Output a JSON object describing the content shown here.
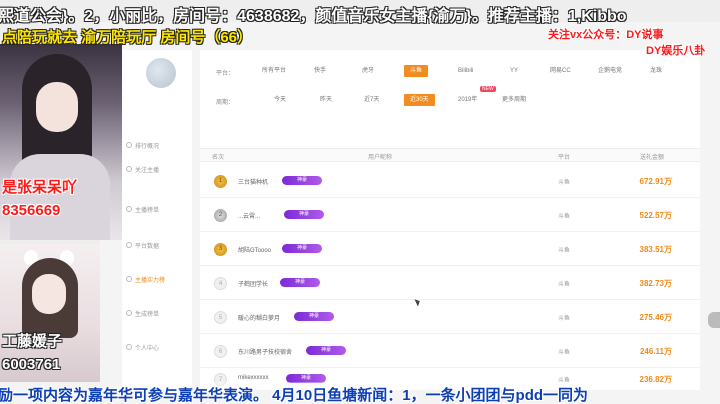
{
  "overlay": {
    "top_banner": "熙道公会}。2，小丽比，房间号：4638682，颜值音乐女主播{渝万}。推荐主播：1,Kibbo",
    "room_line": "点陪玩就去 渝万陪玩厅 房间号（66）",
    "follow_notice": "关注vx公众号：DY说事",
    "follow_notice2": "DY娱乐八卦",
    "streamer1_name": "是张呆呆吖",
    "streamer1_id": "8356669",
    "streamer2_name": "工藤媛子",
    "streamer2_id": "6003761",
    "bottom_banner": "励一项内容为嘉年华可参与嘉年华表演。 4月10日鱼塘新闻：1，一条小团团与pdd一同为"
  },
  "sidebar": {
    "items": [
      {
        "label": "排行概况"
      },
      {
        "label": "关注主播"
      },
      {
        "label": "主播榜单"
      },
      {
        "label": "平台数据"
      },
      {
        "label": "主播实力榜"
      },
      {
        "label": "生成榜单"
      },
      {
        "label": "个人中心"
      }
    ]
  },
  "filters": {
    "platform_label": "平台：",
    "platforms": [
      "所有平台",
      "快手",
      "虎牙",
      "斗鱼",
      "Bilibili",
      "YY",
      "网易CC",
      "企鹅电竞",
      "龙珠"
    ],
    "platform_active": "斗鱼",
    "period_label": "周期：",
    "periods": [
      "今天",
      "昨天",
      "近7天",
      "近30天",
      "2019年",
      "更多周期"
    ],
    "period_active": "近30天",
    "badge_new": "NEW"
  },
  "table": {
    "headers": [
      "名次",
      "用户昵称",
      "平台",
      "送礼金额"
    ],
    "rows": [
      {
        "rank": "1",
        "name": "三台猫种机",
        "tag": "神豪",
        "platform": "斗鱼",
        "value": "672.91万"
      },
      {
        "rank": "2",
        "name": "...云霄...",
        "tag": "神豪",
        "platform": "斗鱼",
        "value": "522.57万"
      },
      {
        "rank": "3",
        "name": "胡陆GToooo",
        "tag": "神豪",
        "platform": "斗鱼",
        "value": "383.51万"
      },
      {
        "rank": "4",
        "name": "子鹤团学长",
        "tag": "神豪",
        "platform": "斗鱼",
        "value": "382.73万"
      },
      {
        "rank": "5",
        "name": "暖心的糊白萝月",
        "tag": "神豪",
        "platform": "斗鱼",
        "value": "275.46万"
      },
      {
        "rank": "6",
        "name": "东川路男子技校宿舍",
        "tag": "神豪",
        "platform": "斗鱼",
        "value": "246.11万"
      },
      {
        "rank": "7",
        "name": "mikexxxxxx",
        "tag": "神豪",
        "platform": "斗鱼",
        "value": "236.82万"
      }
    ]
  }
}
